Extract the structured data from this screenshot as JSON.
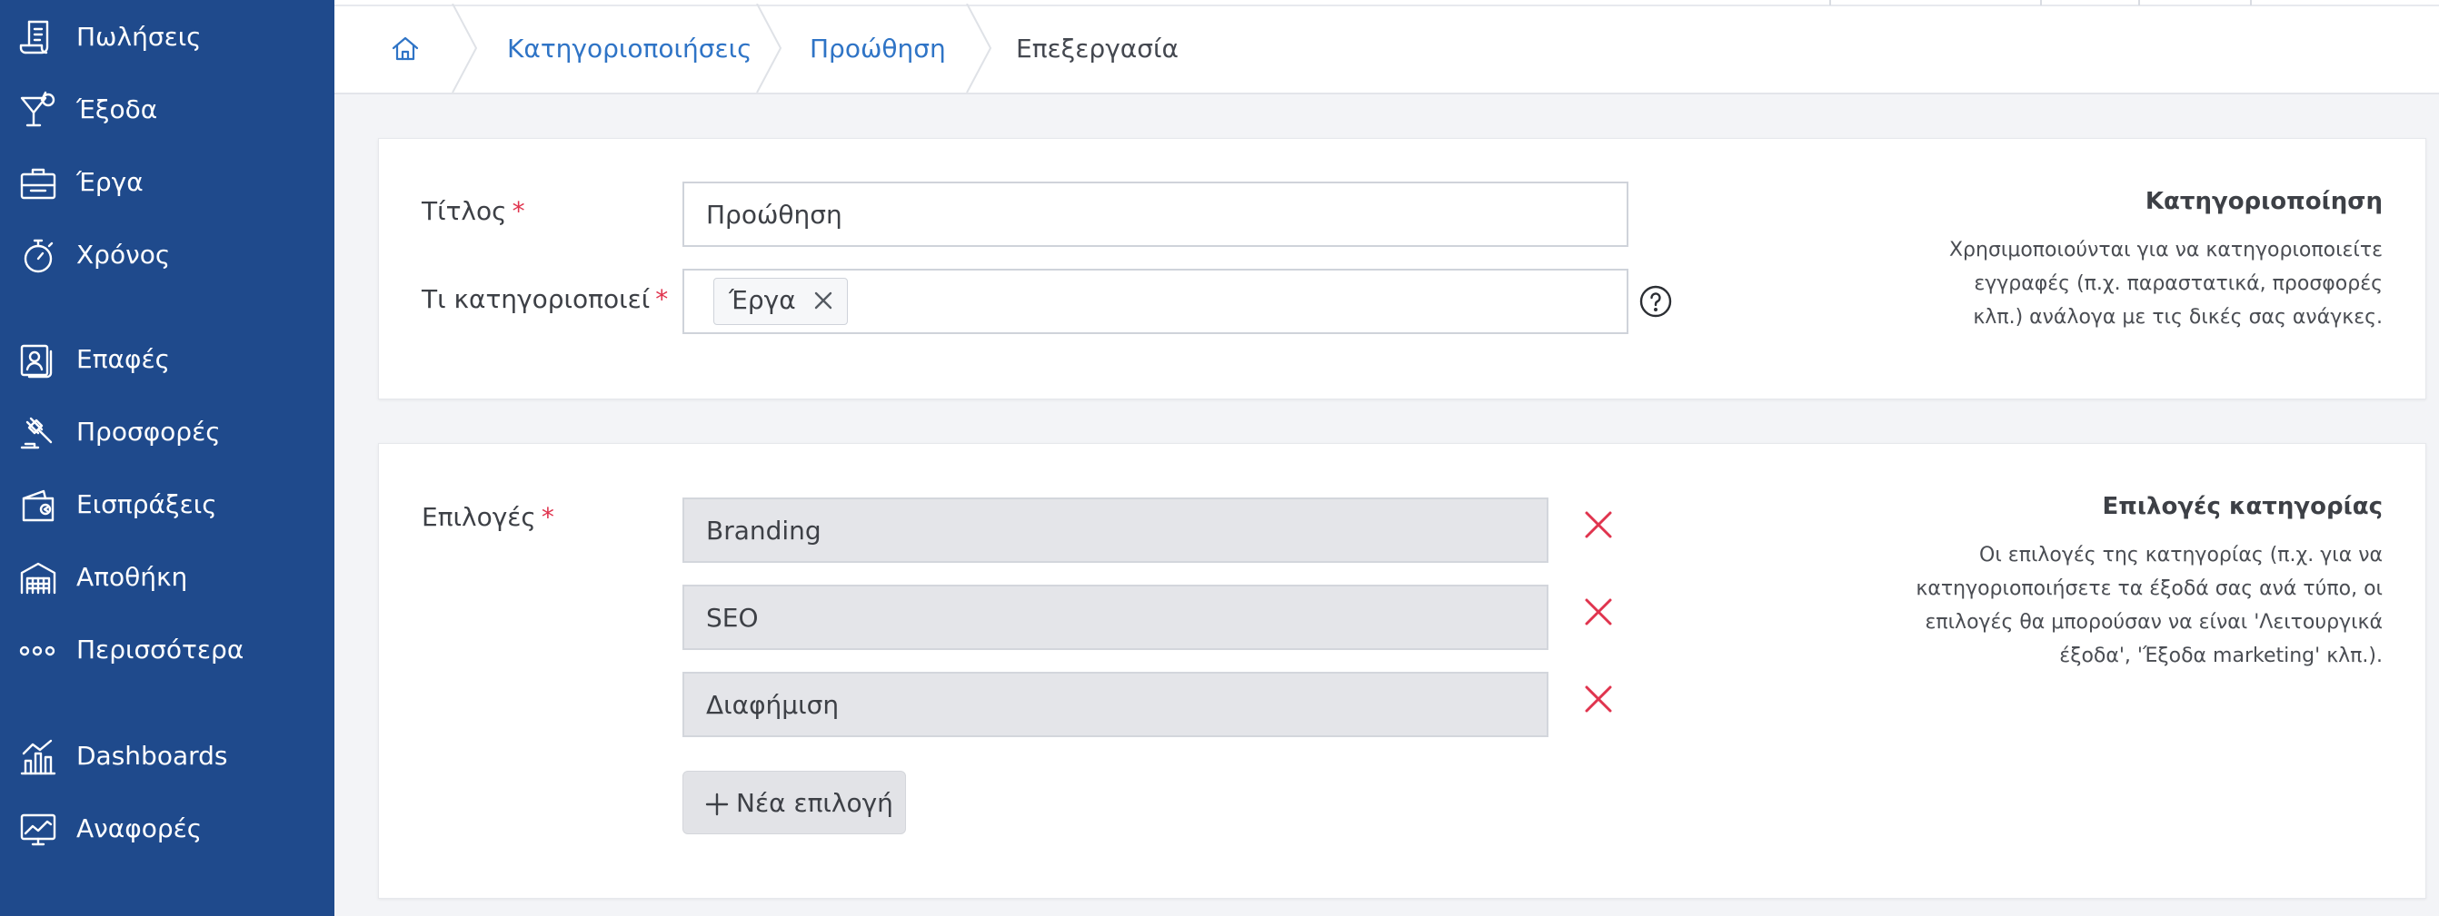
{
  "sidebar": {
    "items": [
      {
        "label": "Πωλήσεις",
        "icon": "invoice-icon"
      },
      {
        "label": "Έξοδα",
        "icon": "cocktail-icon"
      },
      {
        "label": "Έργα",
        "icon": "briefcase-icon"
      },
      {
        "label": "Χρόνος",
        "icon": "stopwatch-icon"
      },
      {
        "label": "Επαφές",
        "icon": "contacts-icon"
      },
      {
        "label": "Προσφορές",
        "icon": "gavel-icon"
      },
      {
        "label": "Εισπράξεις",
        "icon": "wallet-icon"
      },
      {
        "label": "Αποθήκη",
        "icon": "warehouse-icon"
      },
      {
        "label": "Περισσότερα",
        "icon": "more-dots-icon"
      },
      {
        "label": "Dashboards",
        "icon": "dashboard-chart-icon"
      },
      {
        "label": "Αναφορές",
        "icon": "reports-chart-icon"
      }
    ]
  },
  "breadcrumb": {
    "home_icon": "home-icon",
    "items": [
      "Κατηγοριοποιήσεις",
      "Προώθηση",
      "Επεξεργασία"
    ]
  },
  "form1": {
    "title_label": "Τίτλος",
    "title_value": "Προώθηση",
    "categorizes_label": "Τι κατηγοριοποιεί",
    "categorizes_tag": "Έργα",
    "required_mark": "*"
  },
  "info1": {
    "title": "Κατηγοριοποίηση",
    "lines": [
      "Χρησιμοποιούνται για να κατηγοριοποιείτε",
      "εγγραφές (π.χ. παραστατικά, προσφορές",
      "κλπ.) ανάλογα με τις δικές σας ανάγκες."
    ]
  },
  "options": {
    "label": "Επιλογές",
    "values": [
      "Branding",
      "SEO",
      "Διαφήμιση"
    ],
    "add_label": "Νέα επιλογή"
  },
  "info2": {
    "title": "Επιλογές κατηγορίας",
    "lines": [
      "Οι επιλογές της κατηγορίας (π.χ. για να",
      "κατηγοριοποιήσετε τα έξοδά σας ανά τύπο, οι",
      "επιλογές θα μπορούσαν να είναι 'Λειτουργικά",
      "έξοδα', 'Έξοδα marketing' κλπ.)."
    ]
  },
  "colors": {
    "sidebar_bg": "#1f4a8c",
    "link": "#2f74c6",
    "required": "#e0344e",
    "remove": "#e0344e"
  }
}
